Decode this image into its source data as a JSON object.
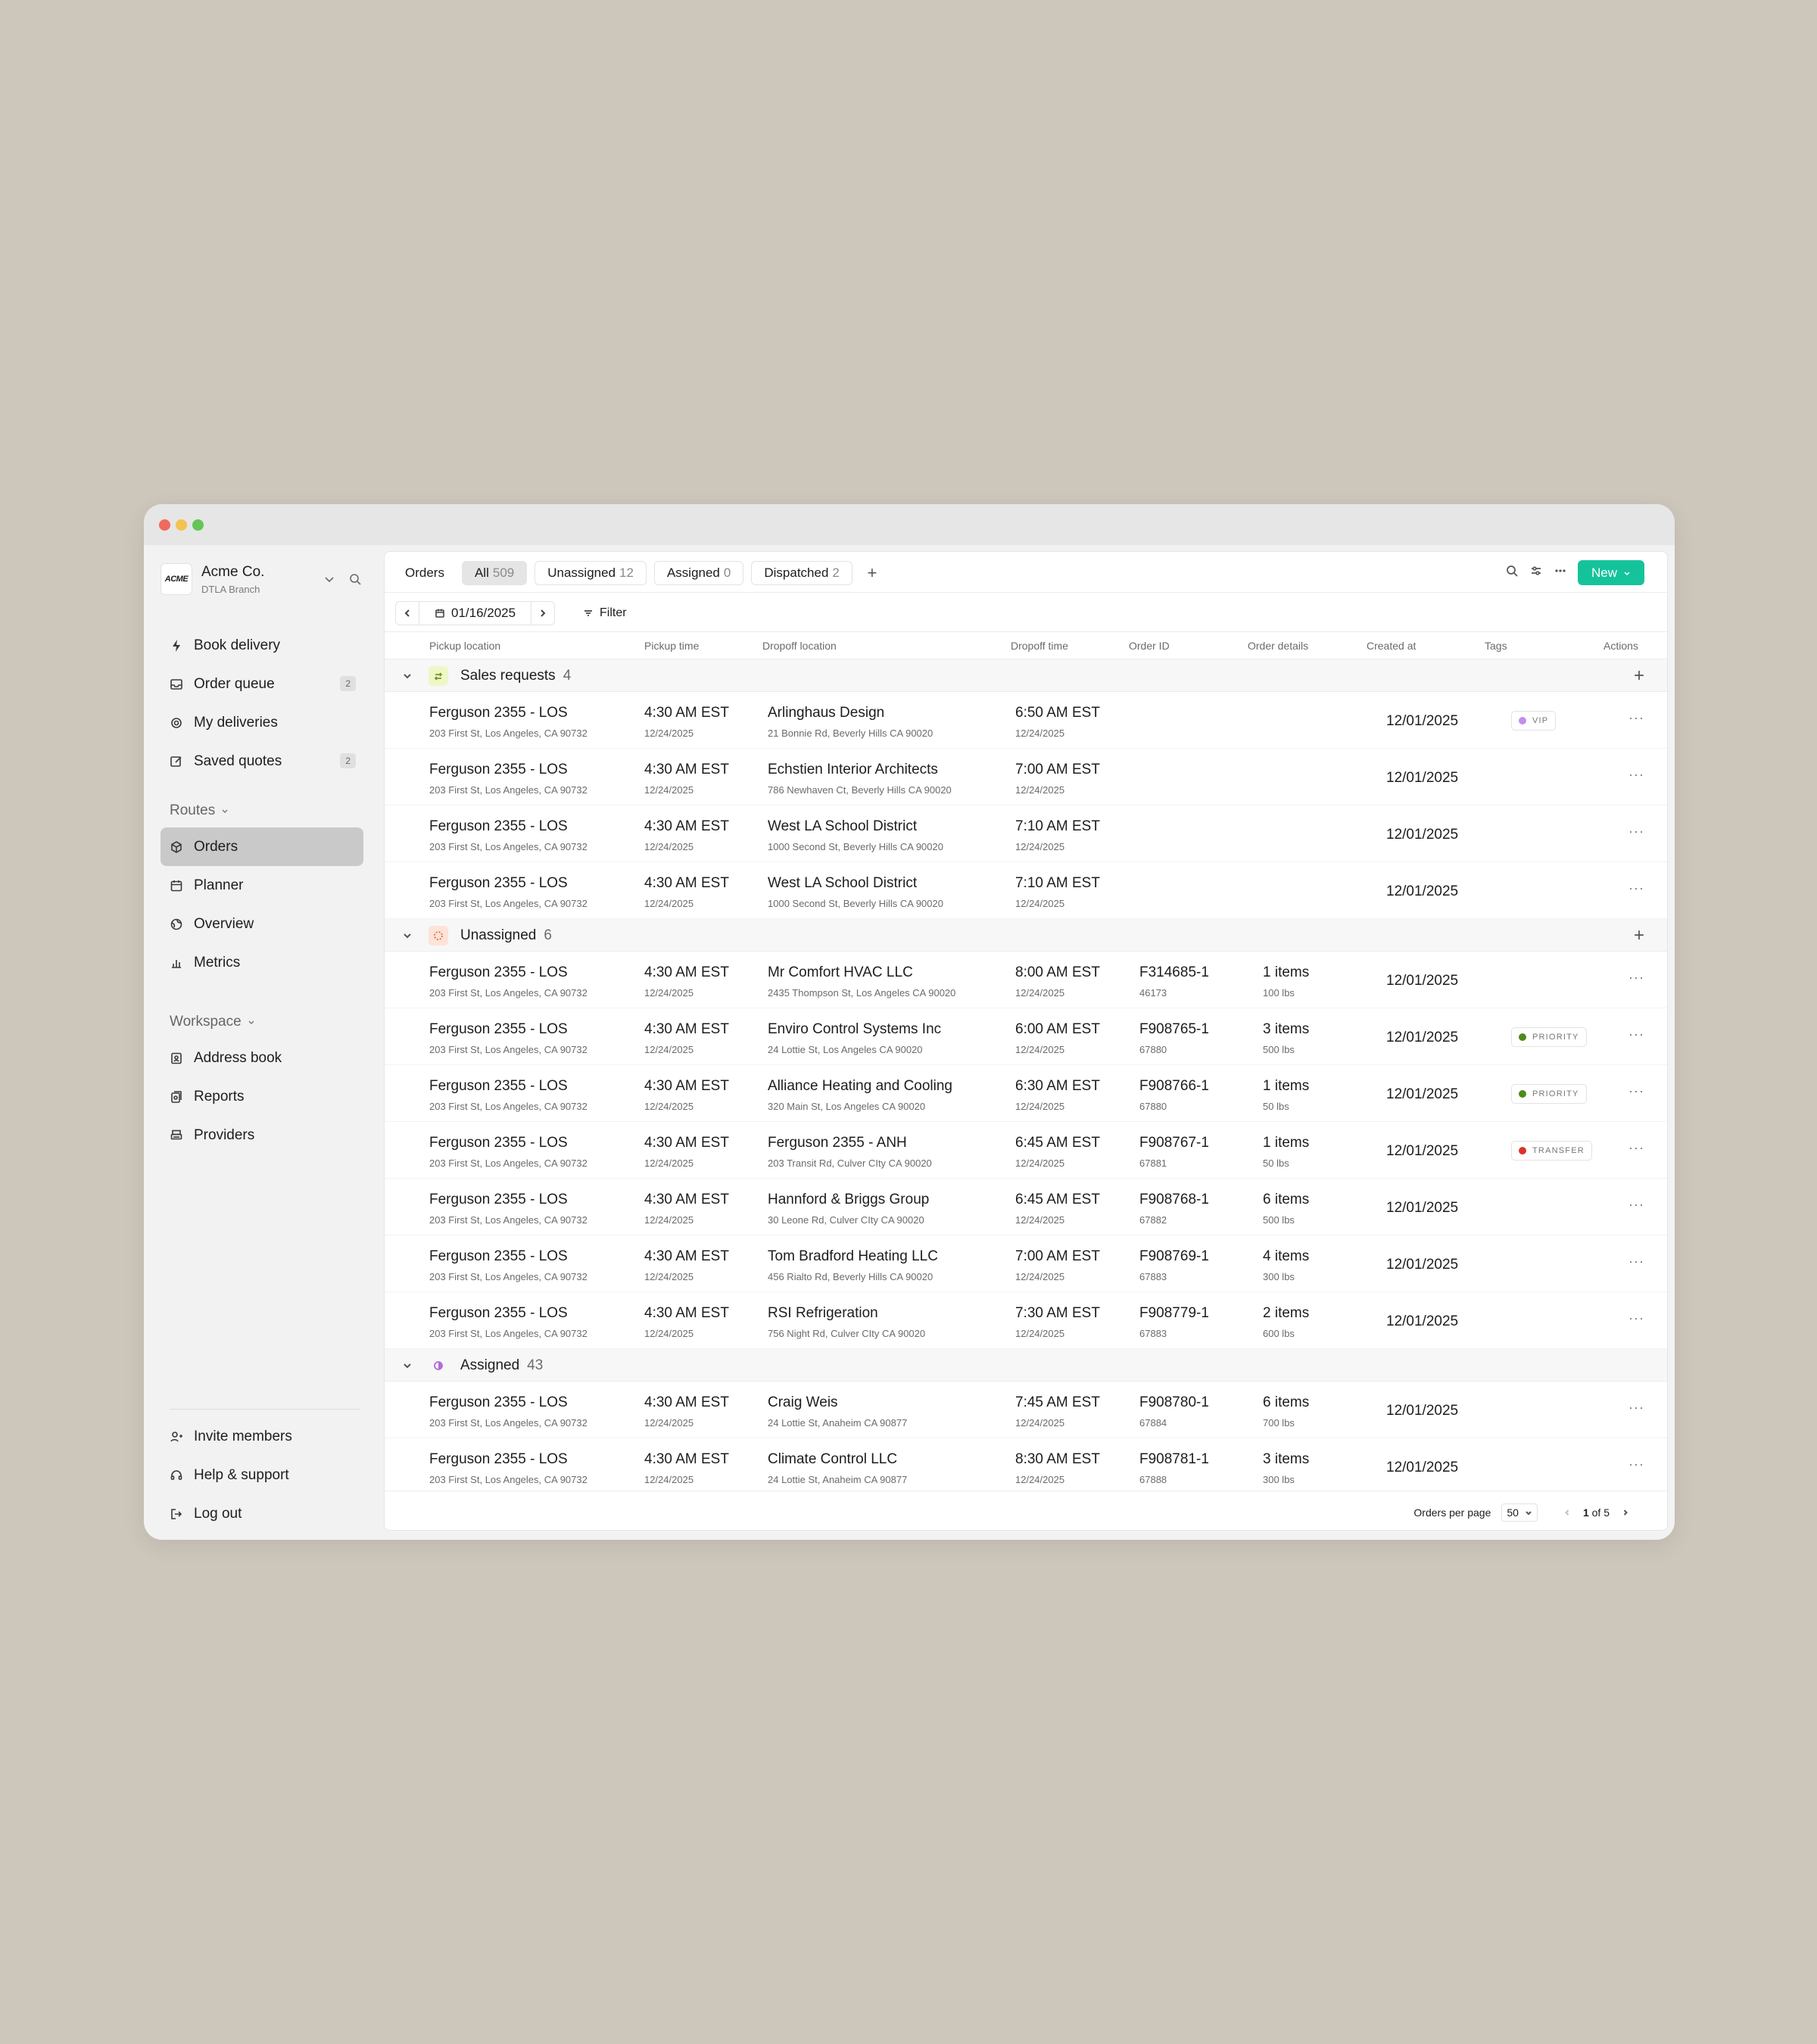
{
  "app": {
    "brand": "Acme Co.",
    "branch": "DTLA Branch",
    "logo_text": "ACME"
  },
  "sidebar": {
    "primary": [
      {
        "label": "Book delivery",
        "icon": "bolt-icon"
      },
      {
        "label": "Order queue",
        "icon": "inbox-icon",
        "badge": "2"
      },
      {
        "label": "My deliveries",
        "icon": "target-icon"
      },
      {
        "label": "Saved quotes",
        "icon": "edit-icon",
        "badge": "2"
      }
    ],
    "routes_label": "Routes",
    "routes": [
      {
        "label": "Orders",
        "icon": "box-icon",
        "active": true
      },
      {
        "label": "Planner",
        "icon": "calendar-icon"
      },
      {
        "label": "Overview",
        "icon": "globe-icon"
      },
      {
        "label": "Metrics",
        "icon": "bar-chart-icon"
      }
    ],
    "workspace_label": "Workspace",
    "workspace": [
      {
        "label": "Address book",
        "icon": "address-book-icon"
      },
      {
        "label": "Reports",
        "icon": "reports-icon"
      },
      {
        "label": "Providers",
        "icon": "printer-icon"
      }
    ],
    "bottom": [
      {
        "label": "Invite members",
        "icon": "user-plus-icon"
      },
      {
        "label": "Help & support",
        "icon": "headset-icon"
      },
      {
        "label": "Log out",
        "icon": "logout-icon"
      }
    ]
  },
  "topbar": {
    "title": "Orders",
    "tabs": [
      {
        "label": "All",
        "count": "509",
        "selected": true
      },
      {
        "label": "Unassigned",
        "count": "12"
      },
      {
        "label": "Assigned",
        "count": "0"
      },
      {
        "label": "Dispatched",
        "count": "2"
      }
    ],
    "add_tab": "+",
    "new_button": "New"
  },
  "datebar": {
    "date": "01/16/2025",
    "filter_label": "Filter"
  },
  "columns": [
    "Pickup location",
    "Pickup time",
    "Dropoff location",
    "Dropoff time",
    "Order ID",
    "Order details",
    "Created at",
    "Tags",
    "Actions"
  ],
  "groups": [
    {
      "label": "Sales requests",
      "count": "4",
      "icon": "swap-icon",
      "icon_bg": "#eef7c8",
      "icon_color": "#7a9a1a",
      "rows": [
        {
          "pickup": "Ferguson 2355 - LOS",
          "pickup_addr": "203 First St, Los Angeles, CA 90732",
          "ptime": "4:30 AM EST",
          "pdate": "12/24/2025",
          "dropoff": "Arlinghaus Design",
          "drop_addr": "21 Bonnie Rd, Beverly Hills CA 90020",
          "dtime": "6:50 AM EST",
          "ddate": "12/24/2025",
          "oid": "",
          "oid_sub": "",
          "items": "",
          "weight": "",
          "created": "12/01/2025",
          "tag": "VIP",
          "tag_color": "#c58cf0"
        },
        {
          "pickup": "Ferguson 2355 - LOS",
          "pickup_addr": "203 First St, Los Angeles, CA 90732",
          "ptime": "4:30 AM EST",
          "pdate": "12/24/2025",
          "dropoff": "Echstien Interior Architects",
          "drop_addr": "786 Newhaven Ct, Beverly Hills CA 90020",
          "dtime": "7:00 AM EST",
          "ddate": "12/24/2025",
          "oid": "",
          "oid_sub": "",
          "items": "",
          "weight": "",
          "created": "12/01/2025",
          "tag": "",
          "tag_color": ""
        },
        {
          "pickup": "Ferguson 2355 - LOS",
          "pickup_addr": "203 First St, Los Angeles, CA 90732",
          "ptime": "4:30 AM EST",
          "pdate": "12/24/2025",
          "dropoff": "West LA School District",
          "drop_addr": "1000 Second St, Beverly Hills CA 90020",
          "dtime": "7:10 AM EST",
          "ddate": "12/24/2025",
          "oid": "",
          "oid_sub": "",
          "items": "",
          "weight": "",
          "created": "12/01/2025",
          "tag": "",
          "tag_color": ""
        },
        {
          "pickup": "Ferguson 2355 - LOS",
          "pickup_addr": "203 First St, Los Angeles, CA 90732",
          "ptime": "4:30 AM EST",
          "pdate": "12/24/2025",
          "dropoff": "West LA School District",
          "drop_addr": "1000 Second St, Beverly Hills CA 90020",
          "dtime": "7:10 AM EST",
          "ddate": "12/24/2025",
          "oid": "",
          "oid_sub": "",
          "items": "",
          "weight": "",
          "created": "12/01/2025",
          "tag": "",
          "tag_color": ""
        }
      ]
    },
    {
      "label": "Unassigned",
      "count": "6",
      "icon": "dashed-circle-icon",
      "icon_bg": "#fde3d8",
      "icon_color": "#e0703f",
      "rows": [
        {
          "pickup": "Ferguson 2355 - LOS",
          "pickup_addr": "203 First St, Los Angeles, CA 90732",
          "ptime": "4:30 AM EST",
          "pdate": "12/24/2025",
          "dropoff": "Mr Comfort HVAC LLC",
          "drop_addr": "2435 Thompson St, Los Angeles CA 90020",
          "dtime": "8:00 AM EST",
          "ddate": "12/24/2025",
          "oid": "F314685-1",
          "oid_sub": "46173",
          "items": "1 items",
          "weight": "100 lbs",
          "created": "12/01/2025",
          "tag": "",
          "tag_color": ""
        },
        {
          "pickup": "Ferguson 2355 - LOS",
          "pickup_addr": "203 First St, Los Angeles, CA 90732",
          "ptime": "4:30 AM EST",
          "pdate": "12/24/2025",
          "dropoff": "Enviro Control Systems Inc",
          "drop_addr": "24 Lottie St, Los Angeles CA 90020",
          "dtime": "6:00 AM EST",
          "ddate": "12/24/2025",
          "oid": "F908765-1",
          "oid_sub": "67880",
          "items": "3 items",
          "weight": "500 lbs",
          "created": "12/01/2025",
          "tag": "PRIORITY",
          "tag_color": "#4f8a1a"
        },
        {
          "pickup": "Ferguson 2355 - LOS",
          "pickup_addr": "203 First St, Los Angeles, CA 90732",
          "ptime": "4:30 AM EST",
          "pdate": "12/24/2025",
          "dropoff": "Alliance Heating and Cooling",
          "drop_addr": "320 Main St, Los Angeles CA 90020",
          "dtime": "6:30 AM EST",
          "ddate": "12/24/2025",
          "oid": "F908766-1",
          "oid_sub": "67880",
          "items": "1 items",
          "weight": "50 lbs",
          "created": "12/01/2025",
          "tag": "PRIORITY",
          "tag_color": "#4f8a1a"
        },
        {
          "pickup": "Ferguson 2355 - LOS",
          "pickup_addr": "203 First St, Los Angeles, CA 90732",
          "ptime": "4:30 AM EST",
          "pdate": "12/24/2025",
          "dropoff": "Ferguson 2355 - ANH",
          "drop_addr": "203 Transit Rd, Culver CIty CA 90020",
          "dtime": "6:45 AM EST",
          "ddate": "12/24/2025",
          "oid": "F908767-1",
          "oid_sub": "67881",
          "items": "1 items",
          "weight": "50 lbs",
          "created": "12/01/2025",
          "tag": "TRANSFER",
          "tag_color": "#d9342b"
        },
        {
          "pickup": "Ferguson 2355 - LOS",
          "pickup_addr": "203 First St, Los Angeles, CA 90732",
          "ptime": "4:30 AM EST",
          "pdate": "12/24/2025",
          "dropoff": "Hannford & Briggs Group",
          "drop_addr": "30 Leone Rd, Culver CIty CA 90020",
          "dtime": "6:45 AM EST",
          "ddate": "12/24/2025",
          "oid": "F908768-1",
          "oid_sub": "67882",
          "items": "6 items",
          "weight": "500 lbs",
          "created": "12/01/2025",
          "tag": "",
          "tag_color": ""
        },
        {
          "pickup": "Ferguson 2355 - LOS",
          "pickup_addr": "203 First St, Los Angeles, CA 90732",
          "ptime": "4:30 AM EST",
          "pdate": "12/24/2025",
          "dropoff": "Tom Bradford Heating LLC",
          "drop_addr": "456 Rialto Rd, Beverly Hills CA 90020",
          "dtime": "7:00 AM EST",
          "ddate": "12/24/2025",
          "oid": "F908769-1",
          "oid_sub": "67883",
          "items": "4 items",
          "weight": "300 lbs",
          "created": "12/01/2025",
          "tag": "",
          "tag_color": ""
        },
        {
          "pickup": "Ferguson 2355 - LOS",
          "pickup_addr": "203 First St, Los Angeles, CA 90732",
          "ptime": "4:30 AM EST",
          "pdate": "12/24/2025",
          "dropoff": "RSI Refrigeration",
          "drop_addr": "756 Night Rd, Culver CIty CA 90020",
          "dtime": "7:30 AM EST",
          "ddate": "12/24/2025",
          "oid": "F908779-1",
          "oid_sub": "67883",
          "items": "2 items",
          "weight": "600 lbs",
          "created": "12/01/2025",
          "tag": "",
          "tag_color": ""
        }
      ]
    },
    {
      "label": "Assigned",
      "count": "43",
      "icon": "half-circle-icon",
      "icon_bg": "transparent",
      "icon_color": "#b36bdc",
      "rows": [
        {
          "pickup": "Ferguson 2355 - LOS",
          "pickup_addr": "203 First St, Los Angeles, CA 90732",
          "ptime": "4:30 AM EST",
          "pdate": "12/24/2025",
          "dropoff": "Craig Weis",
          "drop_addr": "24 Lottie St, Anaheim CA 90877",
          "dtime": "7:45 AM EST",
          "ddate": "12/24/2025",
          "oid": "F908780-1",
          "oid_sub": "67884",
          "items": "6 items",
          "weight": "700 lbs",
          "created": "12/01/2025",
          "tag": "",
          "tag_color": ""
        },
        {
          "pickup": "Ferguson 2355 - LOS",
          "pickup_addr": "203 First St, Los Angeles, CA 90732",
          "ptime": "4:30 AM EST",
          "pdate": "12/24/2025",
          "dropoff": "Climate Control LLC",
          "drop_addr": "24 Lottie St, Anaheim CA 90877",
          "dtime": "8:30 AM EST",
          "ddate": "12/24/2025",
          "oid": "F908781-1",
          "oid_sub": "67888",
          "items": "3 items",
          "weight": "300 lbs",
          "created": "12/01/2025",
          "tag": "",
          "tag_color": ""
        }
      ]
    }
  ],
  "footer": {
    "per_page_label": "Orders per page",
    "per_page": "50",
    "page_current": "1",
    "page_info": "of 5"
  },
  "colors": {
    "accent": "#15c39a",
    "background": "#cdc6bb",
    "active_nav": "#c9c9c9"
  }
}
